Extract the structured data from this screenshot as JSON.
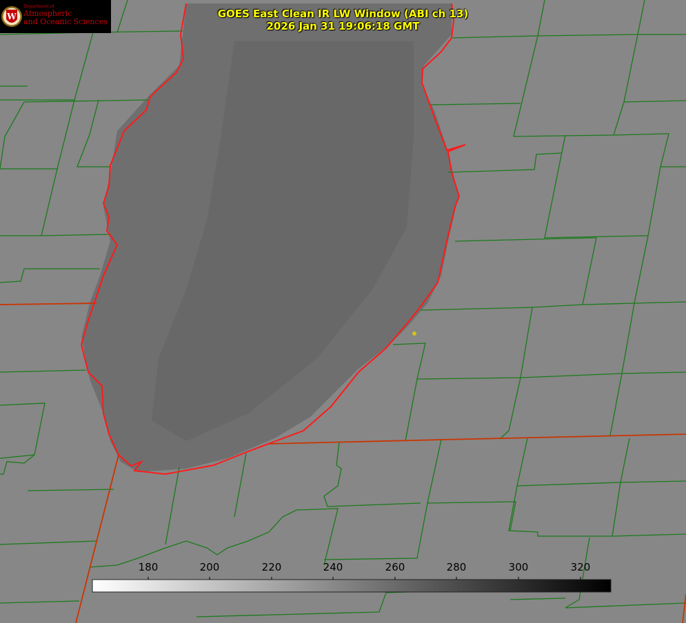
{
  "title": {
    "line1": "GOES East Clean IR LW Window (ABI ch 13)",
    "line2": "2026 Jan 31 19:06:18 GMT"
  },
  "logo": {
    "dept": "Department of",
    "name_line1": "Atmospheric",
    "name_line2": "and Oceanic Sciences",
    "icon": "uw-crest-icon"
  },
  "colorbar": {
    "ticks": [
      "180",
      "200",
      "220",
      "240",
      "260",
      "280",
      "300",
      "320"
    ],
    "gradient": [
      "#ffffff",
      "#000000"
    ]
  },
  "colors": {
    "land": "#878787",
    "lake": "#6e6e6e",
    "county_lines": "#1a7a1a",
    "state_lines": "#cc3300",
    "coastline": "#ff1a1a",
    "title": "#ffff00",
    "marker": "#d4c419"
  }
}
